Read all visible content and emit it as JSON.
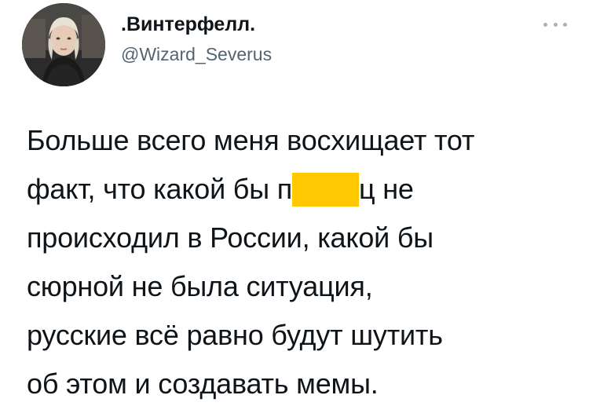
{
  "author": {
    "display_name": ".Винтерфелл.",
    "handle": "@Wizard_Severus",
    "avatar_icon": "profile-photo"
  },
  "menu": {
    "icon": "more-dots-icon"
  },
  "tweet": {
    "line1": "Больше всего меня восхищает тот",
    "line2_before": "факт, что какой бы п",
    "line2_after": "ц не",
    "line3": "происходил в России, какой бы",
    "line4": "сюрной не была ситуация,",
    "line5": "русские всё равно будут шутить",
    "line6": "об этом и создавать мемы."
  },
  "colors": {
    "text": "#0f1419",
    "secondary": "#536471",
    "censor": "#ffc800"
  }
}
